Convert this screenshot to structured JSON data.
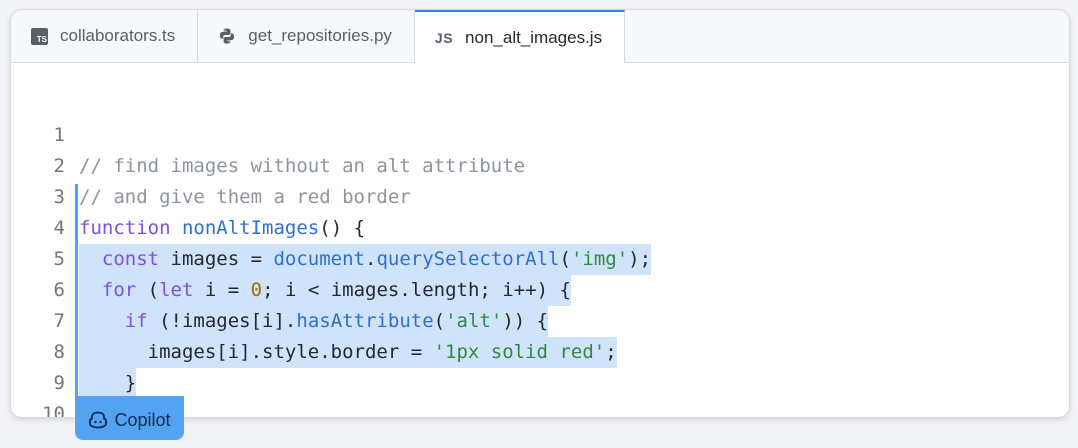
{
  "tabs": [
    {
      "label": "collaborators.ts",
      "icon": "typescript-icon",
      "icon_text": "TS"
    },
    {
      "label": "get_repositories.py",
      "icon": "python-icon"
    },
    {
      "label": "non_alt_images.js",
      "icon": "javascript-icon",
      "icon_text": "JS",
      "active": true
    }
  ],
  "line_numbers": [
    "1",
    "2",
    "3",
    "4",
    "5",
    "6",
    "7",
    "8",
    "9",
    "10"
  ],
  "copilot_label": "Copilot",
  "colors": {
    "accent": "#54a3f3",
    "highlight": "#cfe3fb",
    "keyword": "#8250df",
    "function": "#2f6fd1",
    "string": "#2e8a3c",
    "comment": "#8c959f"
  },
  "code": {
    "l1": "// find images without an alt attribute",
    "l2": "// and give them a red border",
    "l3_kw": "function",
    "l3_fn": "nonAltImages",
    "l3_rest": "() {",
    "l4_indent": "  ",
    "l4_kw": "const",
    "l4_a": " images = ",
    "l4_obj": "document",
    "l4_dot": ".",
    "l4_fn": "querySelectorAll",
    "l4_p1": "(",
    "l4_str": "'img'",
    "l4_p2": ");",
    "l5_indent": "  ",
    "l5_kw1": "for",
    "l5_a": " (",
    "l5_kw2": "let",
    "l5_b": " i = ",
    "l5_num": "0",
    "l5_c": "; i < images.length; i++) {",
    "l6_indent": "    ",
    "l6_kw": "if",
    "l6_a": " (!images[i].",
    "l6_fn": "hasAttribute",
    "l6_b": "(",
    "l6_str": "'alt'",
    "l6_c": ")) {",
    "l7_a": "      images[i].style.border = ",
    "l7_str": "'1px solid red'",
    "l7_b": ";",
    "l8": "    }",
    "l9": "  }",
    "l10": "}"
  }
}
